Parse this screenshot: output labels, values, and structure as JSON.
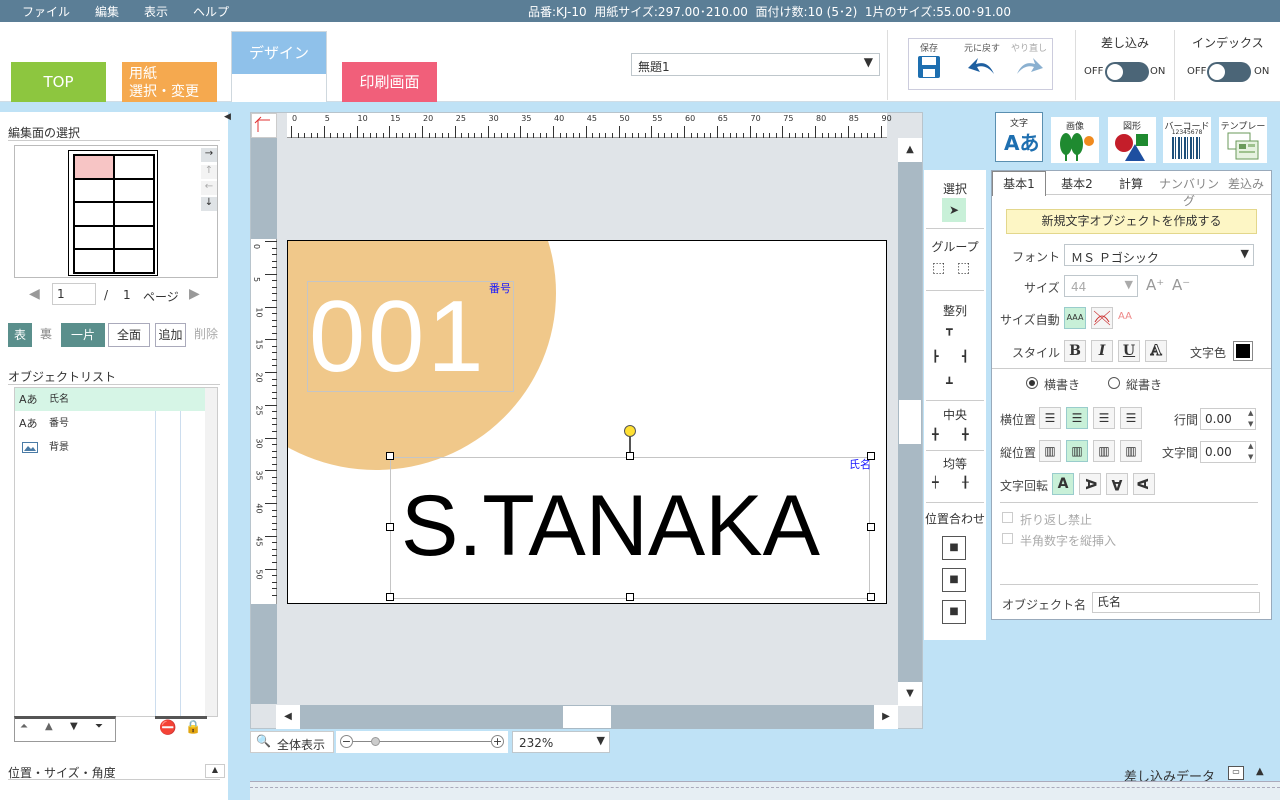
{
  "menu": [
    "ファイル",
    "編集",
    "表示",
    "ヘルプ"
  ],
  "status_line": "品番:KJ-10  用紙サイズ:297.00･210.00  面付け数:10 (5･2)  1片のサイズ:55.00･91.00",
  "tabs": {
    "top": "TOP",
    "paper_1": "用紙",
    "paper_2": "選択・変更",
    "design": "デザイン",
    "print": "印刷画面"
  },
  "document_name": "無題1",
  "toolbar": {
    "save": "保存",
    "undo": "元に戻す",
    "redo": "やり直し"
  },
  "mailmerge": {
    "label": "差し込み",
    "off": "OFF",
    "on": "ON"
  },
  "index": {
    "label": "インデックス",
    "off": "OFF",
    "on": "ON"
  },
  "left": {
    "edit_face_title": "編集面の選択",
    "page_current": "1",
    "page_sep": "/",
    "page_total": "1",
    "page_unit": "ページ",
    "face_front": "表",
    "face_back": "裏",
    "one_piece": "一片",
    "all_faces": "全面",
    "add": "追加",
    "delete": "削除",
    "object_list_title": "オブジェクトリスト",
    "objects": [
      {
        "icon": "Aあ",
        "name": "氏名"
      },
      {
        "icon": "Aあ",
        "name": "番号"
      },
      {
        "icon": "image",
        "name": "背景"
      }
    ],
    "pos_size_title": "位置・サイズ・角度"
  },
  "ruler_top": [
    "0",
    "5",
    "10",
    "15",
    "20",
    "25",
    "30",
    "35",
    "40",
    "45",
    "50",
    "55",
    "60",
    "65",
    "70",
    "75",
    "80",
    "85",
    "90"
  ],
  "ruler_left": [
    "0",
    "5",
    "10",
    "15",
    "20",
    "25",
    "30",
    "35",
    "40",
    "45",
    "50"
  ],
  "canvas": {
    "number_label": "番号",
    "number_text": "001",
    "name_label": "氏名",
    "name_text": "S.TANAKA",
    "circle_color": "#f0c88a"
  },
  "bottom": {
    "fit_all": "全体表示",
    "zoom": "232%",
    "merge_data": "差し込みデータ"
  },
  "tools": {
    "select": "選択",
    "group": "グループ",
    "align": "整列",
    "center": "中央",
    "equal": "均等",
    "position": "位置合わせ"
  },
  "right": {
    "objtypes": [
      "文字",
      "画像",
      "図形",
      "バーコード",
      "テンプレート"
    ],
    "barcode_digits": "12345678",
    "subtabs": [
      "基本1",
      "基本2",
      "計算",
      "ナンバリング",
      "差込み"
    ],
    "create_btn": "新規文字オブジェクトを作成する",
    "font_label": "フォント",
    "font_value": "ＭＳ Ｐゴシック",
    "size_label": "サイズ",
    "size_value": "44",
    "auto_size_label": "サイズ自動",
    "auto_size_glyph": "AAA",
    "auto_shrink_glyph": "AA",
    "style_label": "スタイル",
    "style_buttons": [
      "B",
      "I",
      "U",
      "A"
    ],
    "text_color_label": "文字色",
    "horizontal": "横書き",
    "vertical": "縦書き",
    "hpos_label": "横位置",
    "vpos_label": "縦位置",
    "line_spacing_label": "行間",
    "line_spacing": "0.00",
    "char_spacing_label": "文字間",
    "char_spacing": "0.00",
    "rotation_label": "文字回転",
    "rotation_glyph": "A",
    "no_wrap": "折り返し禁止",
    "half_width_vertical": "半角数字を縦挿入",
    "object_name_label": "オブジェクト名",
    "object_name": "氏名"
  }
}
